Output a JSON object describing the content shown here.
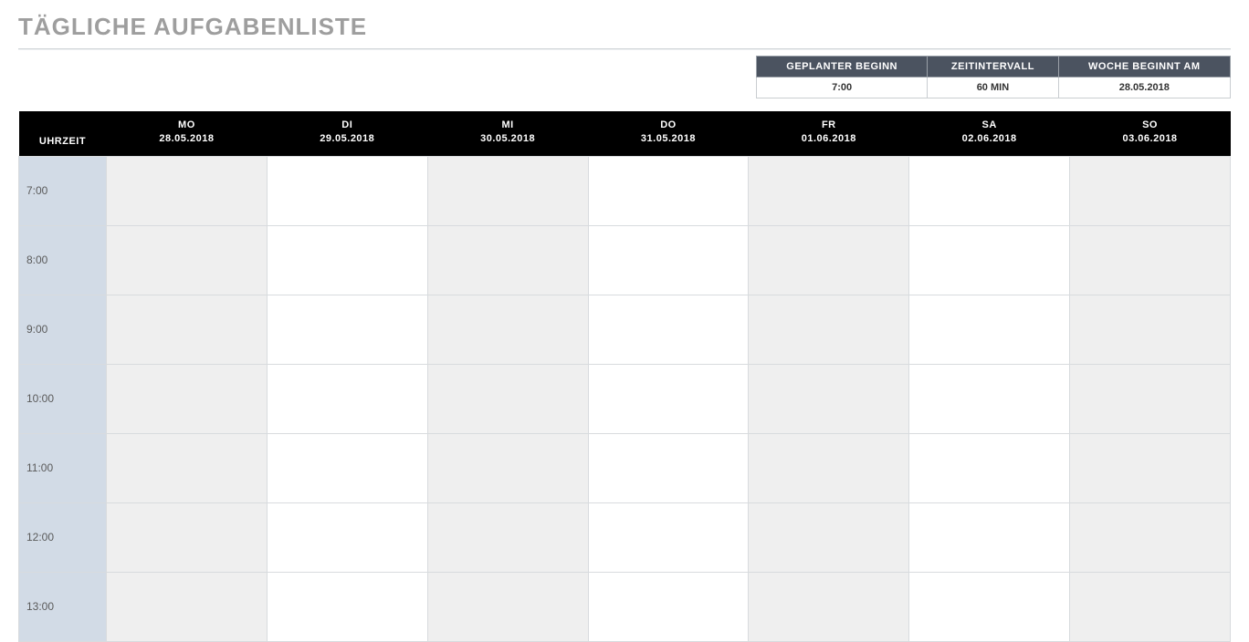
{
  "title": "TÄGLICHE AUFGABENLISTE",
  "settings": {
    "headers": {
      "start": "GEPLANTER BEGINN",
      "interval": "ZEITINTERVALL",
      "weekStart": "WOCHE BEGINNT AM"
    },
    "values": {
      "start": "7:00",
      "interval": "60 MIN",
      "weekStart": "28.05.2018"
    }
  },
  "schedule": {
    "timeHeader": "UHRZEIT",
    "days": [
      {
        "abbr": "MO",
        "date": "28.05.2018"
      },
      {
        "abbr": "DI",
        "date": "29.05.2018"
      },
      {
        "abbr": "MI",
        "date": "30.05.2018"
      },
      {
        "abbr": "DO",
        "date": "31.05.2018"
      },
      {
        "abbr": "FR",
        "date": "01.06.2018"
      },
      {
        "abbr": "SA",
        "date": "02.06.2018"
      },
      {
        "abbr": "SO",
        "date": "03.06.2018"
      }
    ],
    "times": [
      "7:00",
      "8:00",
      "9:00",
      "10:00",
      "11:00",
      "12:00",
      "13:00"
    ]
  }
}
